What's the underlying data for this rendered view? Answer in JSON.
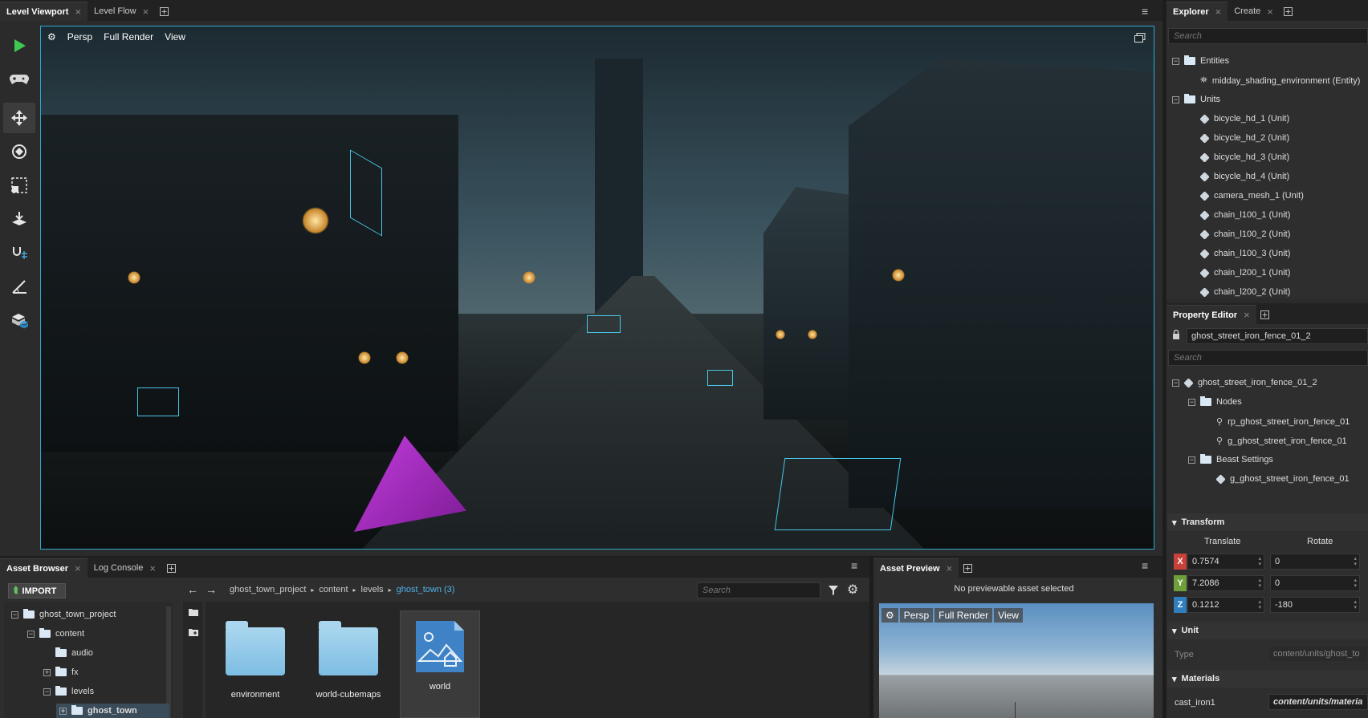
{
  "viewport_tabs": {
    "tabs": [
      {
        "label": "Level Viewport",
        "active": true
      },
      {
        "label": "Level Flow",
        "active": false
      }
    ]
  },
  "viewport": {
    "toolbar": {
      "camera": "Persp",
      "render": "Full Render",
      "view": "View"
    }
  },
  "explorer": {
    "tabs": [
      {
        "label": "Explorer",
        "active": true
      },
      {
        "label": "Create",
        "active": false
      }
    ],
    "search_placeholder": "Search",
    "items": [
      {
        "label": "Entities",
        "type": "group",
        "depth": 0
      },
      {
        "label": "midday_shading_environment (Entity)",
        "type": "entity",
        "depth": 1
      },
      {
        "label": "Units",
        "type": "group",
        "depth": 0
      },
      {
        "label": "bicycle_hd_1 (Unit)",
        "type": "unit",
        "depth": 1
      },
      {
        "label": "bicycle_hd_2 (Unit)",
        "type": "unit",
        "depth": 1
      },
      {
        "label": "bicycle_hd_3 (Unit)",
        "type": "unit",
        "depth": 1
      },
      {
        "label": "bicycle_hd_4 (Unit)",
        "type": "unit",
        "depth": 1
      },
      {
        "label": "camera_mesh_1 (Unit)",
        "type": "unit",
        "depth": 1
      },
      {
        "label": "chain_l100_1 (Unit)",
        "type": "unit",
        "depth": 1
      },
      {
        "label": "chain_l100_2 (Unit)",
        "type": "unit",
        "depth": 1
      },
      {
        "label": "chain_l100_3 (Unit)",
        "type": "unit",
        "depth": 1
      },
      {
        "label": "chain_l200_1 (Unit)",
        "type": "unit",
        "depth": 1
      },
      {
        "label": "chain_l200_2 (Unit)",
        "type": "unit",
        "depth": 1
      }
    ]
  },
  "property_editor": {
    "tab": "Property Editor",
    "name_value": "ghost_street_iron_fence_01_2",
    "search_placeholder": "Search",
    "tree": [
      {
        "label": "ghost_street_iron_fence_01_2",
        "depth": 0,
        "kind": "unit",
        "expand": true
      },
      {
        "label": "Nodes",
        "depth": 1,
        "kind": "folder",
        "expand": true
      },
      {
        "label": "rp_ghost_street_iron_fence_01",
        "depth": 2,
        "kind": "node"
      },
      {
        "label": "g_ghost_street_iron_fence_01",
        "depth": 2,
        "kind": "node"
      },
      {
        "label": "Beast Settings",
        "depth": 1,
        "kind": "folder",
        "expand": true
      },
      {
        "label": "g_ghost_street_iron_fence_01",
        "depth": 2,
        "kind": "unit"
      }
    ],
    "transform": {
      "title": "Transform",
      "translate_label": "Translate",
      "rotate_label": "Rotate",
      "rows": [
        {
          "axis": "X",
          "color": "#c8413a",
          "translate": "0.7574",
          "rotate": "0"
        },
        {
          "axis": "Y",
          "color": "#6e9f3a",
          "translate": "7.2086",
          "rotate": "0"
        },
        {
          "axis": "Z",
          "color": "#2f7fbf",
          "translate": "0.1212",
          "rotate": "-180"
        }
      ]
    },
    "unit": {
      "title": "Unit",
      "type_label": "Type",
      "type_value": "content/units/ghost_to"
    },
    "materials": {
      "title": "Materials",
      "name": "cast_iron1",
      "value": "content/units/materia"
    }
  },
  "asset_browser": {
    "tabs": [
      {
        "label": "Asset Browser",
        "active": true
      },
      {
        "label": "Log Console",
        "active": false
      }
    ],
    "import_label": "IMPORT",
    "path": [
      "ghost_town_project",
      "content",
      "levels"
    ],
    "current": "ghost_town (3)",
    "search_placeholder": "Search",
    "tree": [
      {
        "label": "ghost_town_project",
        "depth": 0,
        "expand": "minus"
      },
      {
        "label": "content",
        "depth": 1,
        "expand": "minus"
      },
      {
        "label": "audio",
        "depth": 2,
        "expand": "none"
      },
      {
        "label": "fx",
        "depth": 2,
        "expand": "plus"
      },
      {
        "label": "levels",
        "depth": 2,
        "expand": "minus"
      },
      {
        "label": "ghost_town",
        "depth": 3,
        "expand": "plus",
        "selected": true
      }
    ],
    "assets": [
      {
        "label": "environment",
        "kind": "folder"
      },
      {
        "label": "world-cubemaps",
        "kind": "folder"
      },
      {
        "label": "world",
        "kind": "level",
        "selected": true
      }
    ]
  },
  "asset_preview": {
    "tab": "Asset Preview",
    "message": "No previewable asset selected",
    "toolbar": {
      "camera": "Persp",
      "render": "Full Render",
      "view": "View"
    }
  }
}
